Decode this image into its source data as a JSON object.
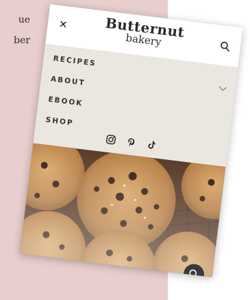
{
  "background": {
    "visible_fragments": [
      "ue",
      "ber"
    ]
  },
  "header": {
    "close_icon": "close-icon",
    "logo_line1": "Butternut",
    "logo_line2": "bakery",
    "search_icon": "search-icon"
  },
  "menu": {
    "items": [
      {
        "label": "RECIPES"
      },
      {
        "label": "ABOUT"
      },
      {
        "label": "EBOOK"
      },
      {
        "label": "SHOP"
      }
    ],
    "expand_icon": "chevron-down-icon"
  },
  "social": [
    "instagram-icon",
    "pinterest-icon",
    "tiktok-icon"
  ],
  "colors": {
    "pink_bg": "#e8cfce",
    "menu_bg": "#eae7e0",
    "fab_bg": "#3a3a3a"
  }
}
